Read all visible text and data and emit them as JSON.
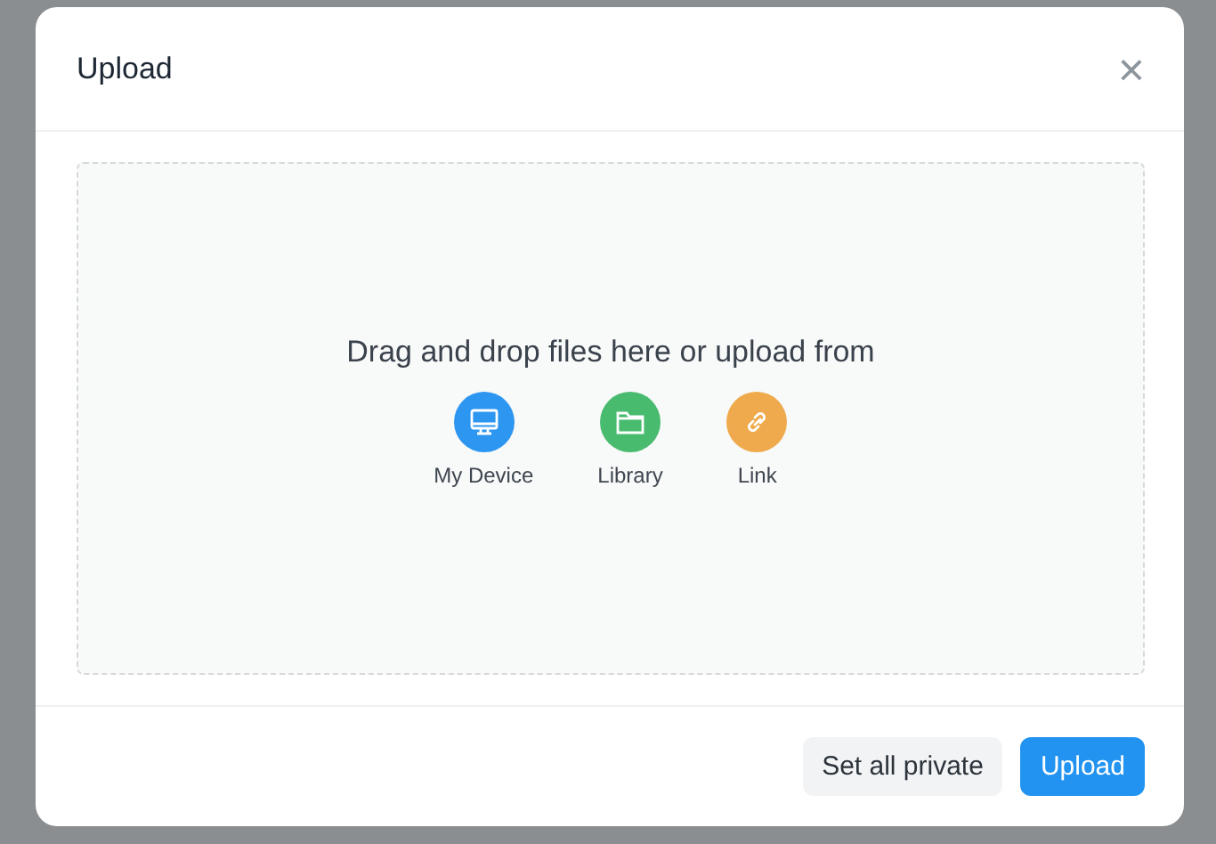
{
  "dialog": {
    "title": "Upload",
    "close": "×"
  },
  "dropzone": {
    "prompt": "Drag and drop files here or upload from",
    "sources": [
      {
        "kind": "device",
        "label": "My Device",
        "color": "#2d96f0"
      },
      {
        "kind": "library",
        "label": "Library",
        "color": "#48bb6e"
      },
      {
        "kind": "link",
        "label": "Link",
        "color": "#eeaa4c"
      }
    ]
  },
  "buttons": [
    {
      "kind": "secondary",
      "label": "Set all private"
    },
    {
      "kind": "primary",
      "label": "Upload"
    }
  ]
}
